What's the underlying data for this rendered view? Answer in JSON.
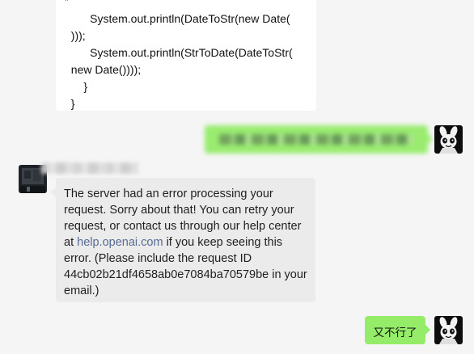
{
  "chat": {
    "code_snippet": "”\n        System.out.println(DateToStr(new Date(\n  )));\n        System.out.println(StrToDate(DateToStr(\n  new Date())));\n      }\n  }",
    "error_message": {
      "part1": "The server had an error processing your request. Sorry about that! You can retry your request, or contact us through our help center at ",
      "link": "help.openai.com",
      "part2": " if you keep seeing this error. (Please include the request ID 44cb02b21df4658ab0e7084ba70579be in your email.)"
    },
    "reply_text": "又不行了"
  },
  "colors": {
    "background": "#f5f5f5",
    "outgoing_bubble": "#95ec69",
    "incoming_bubble": "#ebebeb",
    "link": "#576b95"
  },
  "icons": {
    "user_avatar": "panda-avatar-icon",
    "contact_avatar": "dark-avatar-icon"
  }
}
